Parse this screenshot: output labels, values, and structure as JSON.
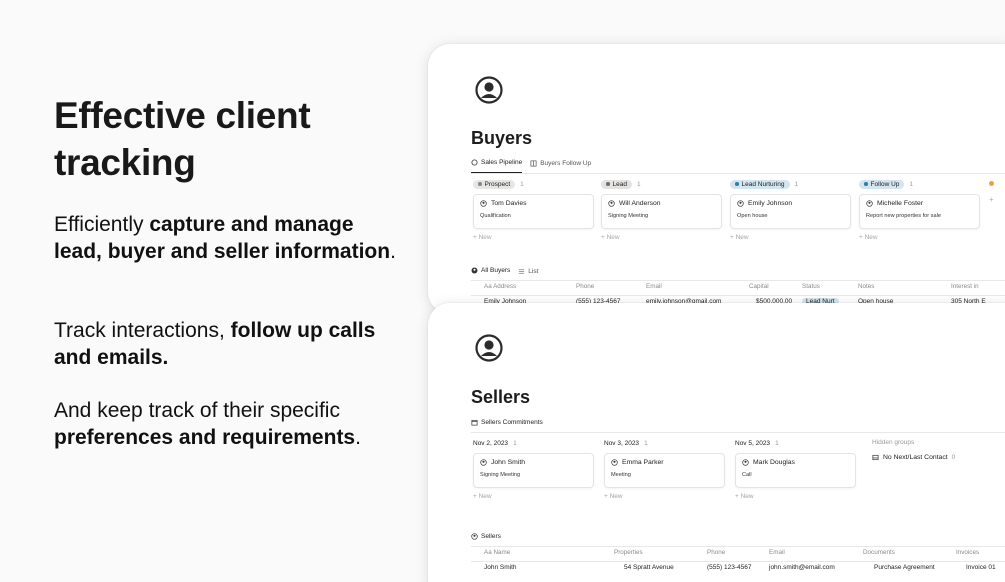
{
  "hero": {
    "title": "Effective client tracking",
    "p1": {
      "pre": "Efficiently ",
      "bold": "capture and manage lead, buyer and seller information",
      "post": "."
    },
    "p2": {
      "pre": "Track interactions, ",
      "bold": "follow up calls and emails.",
      "post": ""
    },
    "p3": {
      "pre": "And keep track of their specific ",
      "bold": "preferences and requirements",
      "post": "."
    }
  },
  "buyers": {
    "title": "Buyers",
    "tabs": [
      "Sales Pipeline",
      "Buyers Follow Up"
    ],
    "columns": [
      {
        "label": "Prospect",
        "count": "1",
        "color": "#e6e6e4",
        "dot": "#8a8a8a",
        "card_name": "Tom Davies",
        "card_sub": "Qualification",
        "new": "+ New"
      },
      {
        "label": "Lead",
        "count": "1",
        "color": "#e3e2e0",
        "dot": "#6f6f6f",
        "card_name": "Will Anderson",
        "card_sub": "Signing Meeting",
        "new": "+ New"
      },
      {
        "label": "Lead Nurturing",
        "count": "1",
        "color": "#d3e5ef",
        "dot": "#337ea9",
        "card_name": "Emily Johnson",
        "card_sub": "Open house",
        "new": "+ New"
      },
      {
        "label": "Follow Up",
        "count": "1",
        "color": "#d3e5ef",
        "dot": "#337ea9",
        "card_name": "Michelle Foster",
        "card_sub": "Report new properties for sale",
        "new": "+ New"
      }
    ],
    "view_tabs": [
      "All Buyers",
      "List"
    ],
    "table_headers": [
      "Aa Address",
      "Phone",
      "Email",
      "Capital",
      "Status",
      "Notes",
      "Interest in"
    ],
    "row": {
      "address": "Emily Johnson",
      "phone": "(555) 123-4567",
      "email": "emily.johnson@gmail.com",
      "capital": "$500,000.00",
      "status": "Lead Nurt",
      "notes": "Open house",
      "interest": "305 North E"
    },
    "plus": "+"
  },
  "sellers": {
    "title": "Sellers",
    "tabs": [
      "Sellers Commitments"
    ],
    "columns": [
      {
        "label": "Nov 2, 2023",
        "count": "1",
        "card_name": "John Smith",
        "card_sub": "Signing Meeting",
        "new": "+ New"
      },
      {
        "label": "Nov 3, 2023",
        "count": "1",
        "card_name": "Emma Parker",
        "card_sub": "Meeting",
        "new": "+ New"
      },
      {
        "label": "Nov 5, 2023",
        "count": "1",
        "card_name": "Mark Douglas",
        "card_sub": "Call",
        "new": "+ New"
      }
    ],
    "hidden_groups": "Hidden groups",
    "no_contact": "No Next/Last Contact",
    "no_contact_count": "0",
    "view_tab": "Sellers",
    "table_headers": [
      "Aa Name",
      "Properties",
      "Phone",
      "Email",
      "Documents",
      "Invoices"
    ],
    "row": {
      "name": "John Smith",
      "property": "54 Spratt Avenue",
      "phone": "(555) 123-4567",
      "email": "john.smith@email.com",
      "document": "Purchase Agreement",
      "invoice": "Invoice 01"
    }
  }
}
